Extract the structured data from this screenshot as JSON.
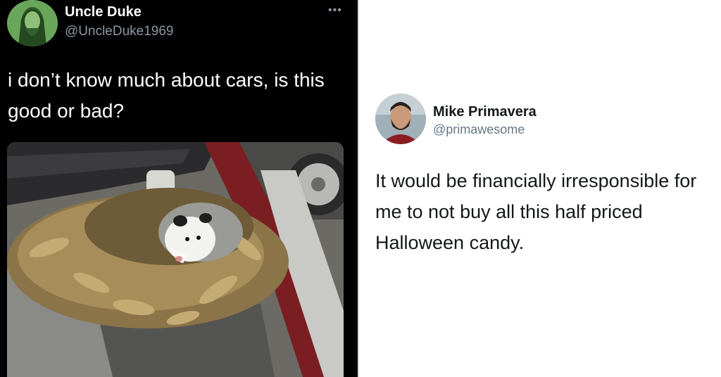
{
  "left_tweet": {
    "display_name": "Uncle Duke",
    "handle": "@UncleDuke1969",
    "more_icon": "ellipsis-icon",
    "text": "i don’t know much about cars, is this good or bad?",
    "photo_description_icon": "opossum-in-engine-photo"
  },
  "right_tweet": {
    "display_name": "Mike Primavera",
    "handle": "@primawesome",
    "text": "It would be financially irresponsible for me to not buy all this half priced Halloween candy."
  },
  "colors": {
    "dark_bg": "#000000",
    "light_bg": "#ffffff",
    "secondary_text_dark": "#8b98a5",
    "secondary_text_light": "#657786"
  }
}
